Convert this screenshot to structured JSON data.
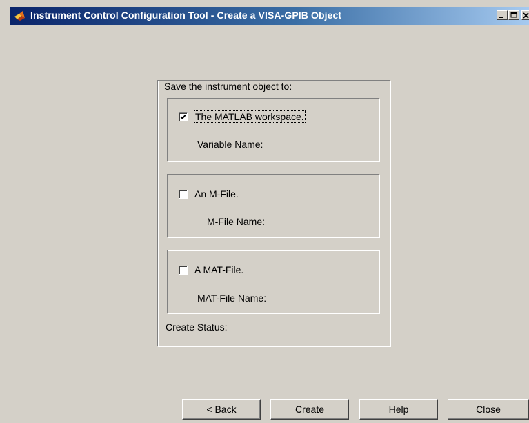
{
  "window": {
    "title": "Instrument Control Configuration Tool - Create a VISA-GPIB Object",
    "minimize_icon": "minimize-icon",
    "maximize_icon": "maximize-icon",
    "close_icon": "close-icon",
    "app_icon": "matlab-icon"
  },
  "group": {
    "legend": "Save the instrument object to:",
    "options": [
      {
        "label": "The MATLAB workspace.",
        "checked": true,
        "sub_label": "Variable Name:"
      },
      {
        "label": "An M-File.",
        "checked": false,
        "sub_label": "M-File Name:"
      },
      {
        "label": "A MAT-File.",
        "checked": false,
        "sub_label": "MAT-File Name:"
      }
    ],
    "status_label": "Create Status:"
  },
  "buttons": {
    "back": "< Back",
    "create": "Create",
    "help": "Help",
    "close": "Close"
  }
}
